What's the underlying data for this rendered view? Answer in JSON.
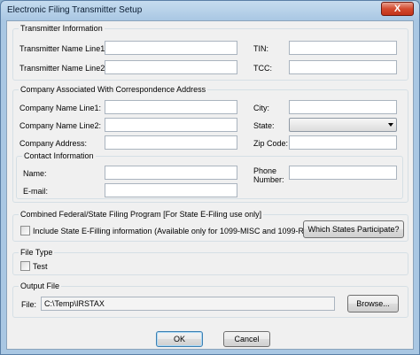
{
  "window": {
    "title": "Electronic Filing Transmitter Setup",
    "close_glyph": "X"
  },
  "transmitter": {
    "title": "Transmitter Information",
    "name_line1_label": "Transmitter Name Line1:",
    "name_line2_label": "Transmitter Name Line2:",
    "tin_label": "TIN:",
    "tcc_label": "TCC:",
    "name_line1_value": "",
    "name_line2_value": "",
    "tin_value": "",
    "tcc_value": ""
  },
  "company": {
    "title": "Company Associated With Correspondence Address",
    "name_line1_label": "Company Name Line1:",
    "name_line2_label": "Company Name Line2:",
    "address_label": "Company Address:",
    "city_label": "City:",
    "state_label": "State:",
    "zip_label": "Zip Code:",
    "name_line1_value": "",
    "name_line2_value": "",
    "address_value": "",
    "city_value": "",
    "state_value": "",
    "zip_value": "",
    "contact": {
      "title": "Contact Information",
      "name_label": "Name:",
      "email_label": "E-mail:",
      "phone_label_line1": "Phone",
      "phone_label_line2": "Number:",
      "name_value": "",
      "email_value": "",
      "phone_value": ""
    }
  },
  "combined": {
    "title": "Combined Federal/State Filing Program  [For State E-Filing use only]",
    "checkbox_label": "Include State E-Filling information (Available only for 1099-MISC and 1099-R)",
    "checked": false,
    "states_button": "Which States Participate?"
  },
  "file_type": {
    "title": "File Type",
    "test_label": "Test",
    "checked": false
  },
  "output": {
    "title": "Output File",
    "file_label": "File:",
    "file_value": "C:\\Temp\\IRSTAX",
    "browse_button": "Browse..."
  },
  "buttons": {
    "ok": "OK",
    "cancel": "Cancel"
  }
}
